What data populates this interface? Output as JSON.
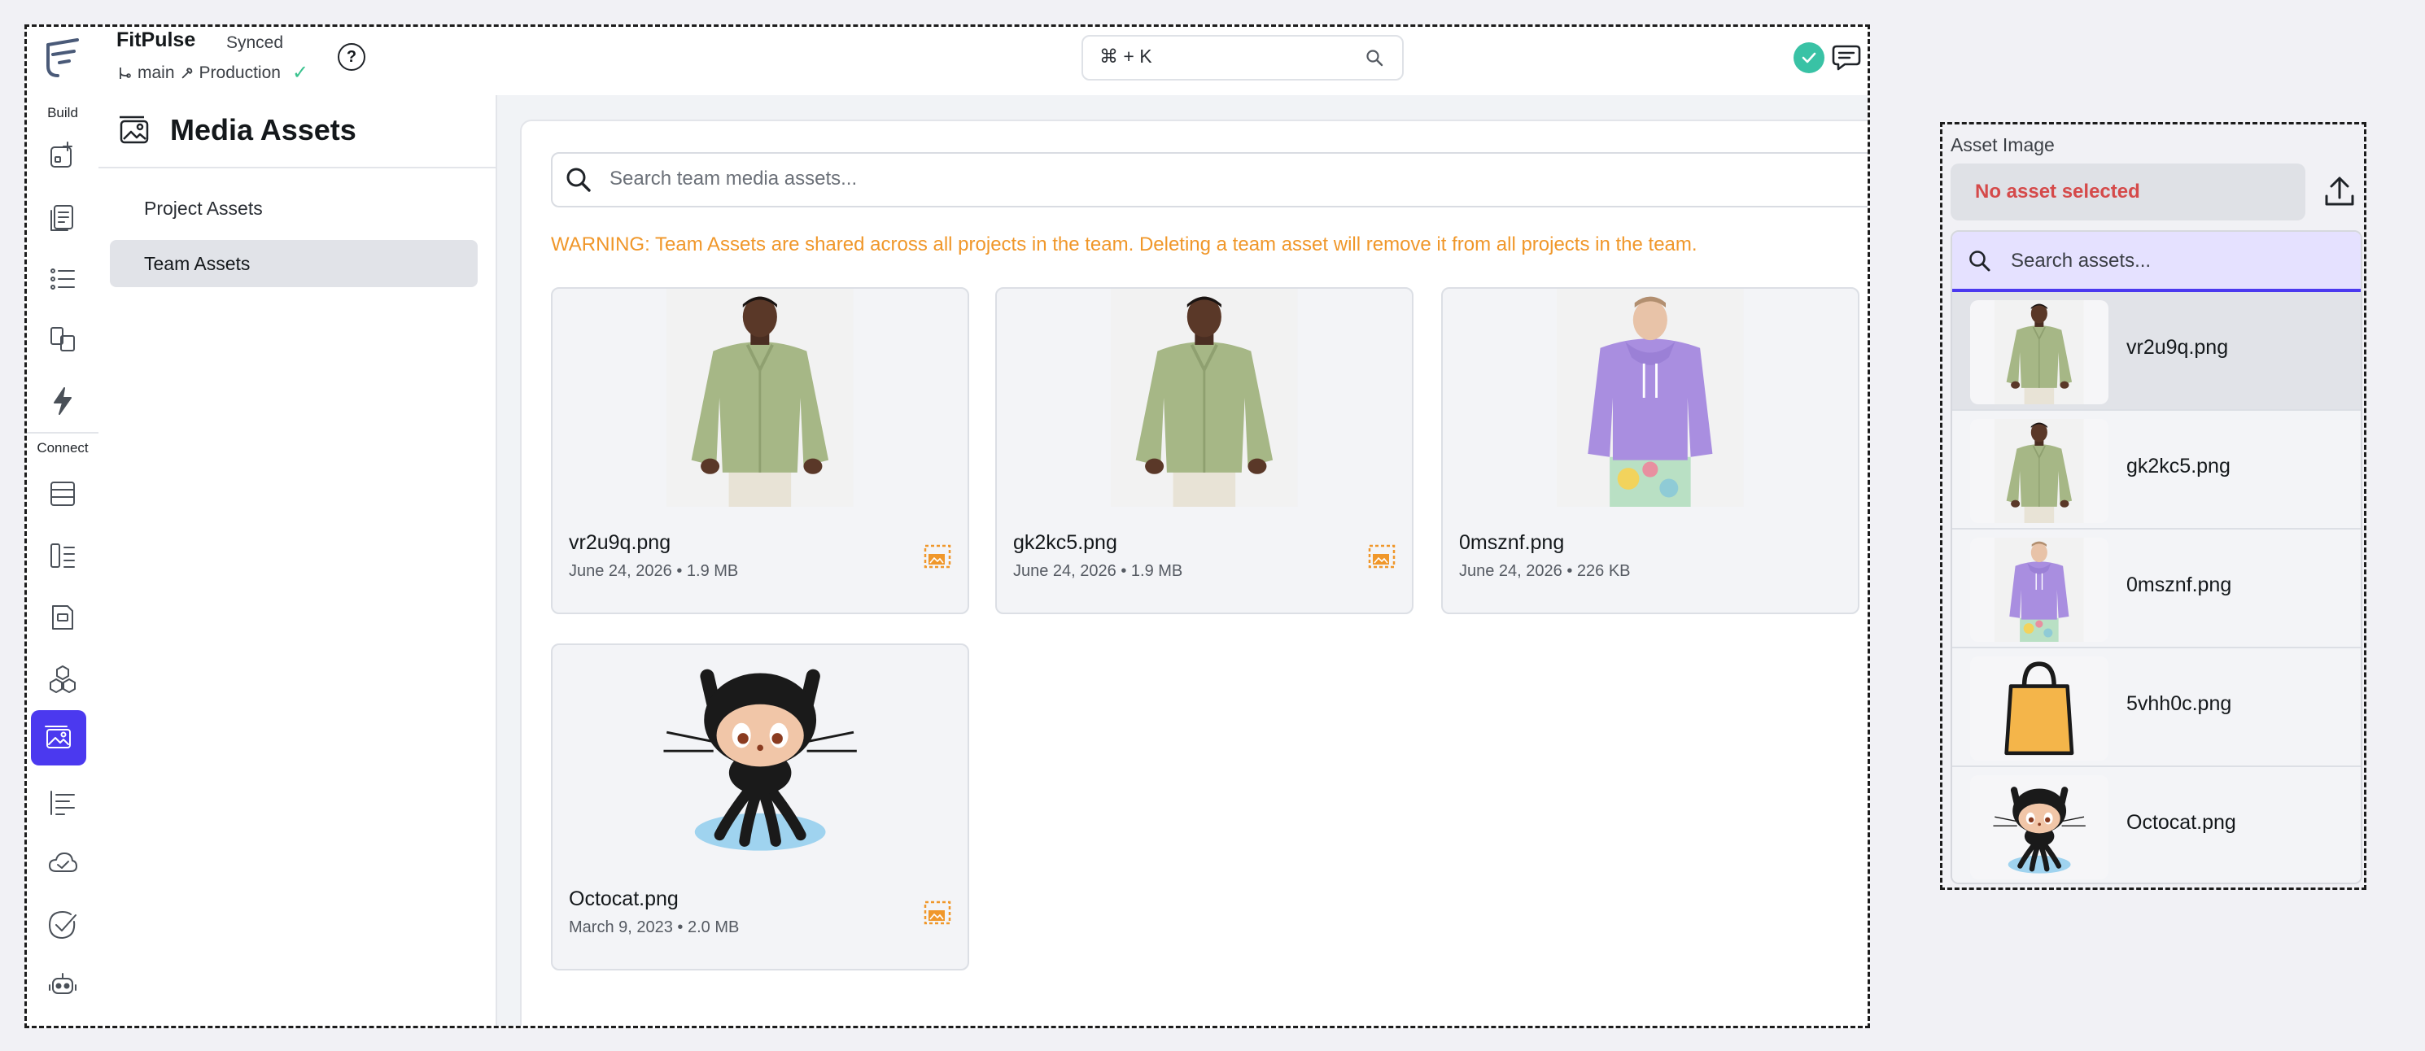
{
  "app": {
    "project_name": "FitPulse",
    "sync_status": "Synced",
    "branch": "main",
    "environment": "Production",
    "help_label": "?",
    "command_shortcut": "⌘ + K"
  },
  "rail": {
    "build_label": "Build",
    "connect_label": "Connect"
  },
  "subnav": {
    "title": "Media Assets",
    "items": [
      {
        "label": "Project Assets",
        "selected": false
      },
      {
        "label": "Team Assets",
        "selected": true
      }
    ]
  },
  "main": {
    "search_placeholder": "Search team media assets...",
    "warning": "WARNING: Team Assets are shared across all projects in the team. Deleting a team asset will remove it from all projects in the team.",
    "assets": [
      {
        "name": "vr2u9q.png",
        "meta": "June 24, 2026 • 1.9 MB",
        "thumb": "green-jacket"
      },
      {
        "name": "gk2kc5.png",
        "meta": "June 24, 2026 • 1.9 MB",
        "thumb": "green-jacket"
      },
      {
        "name": "0msznf.png",
        "meta": "June 24, 2026 • 226 KB",
        "thumb": "purple-hoodie"
      },
      {
        "name": "Octocat.png",
        "meta": "March 9, 2023 • 2.0 MB",
        "thumb": "octocat"
      }
    ]
  },
  "picker": {
    "label": "Asset Image",
    "empty_text": "No asset selected",
    "search_placeholder": "Search assets...",
    "items": [
      {
        "name": "vr2u9q.png",
        "thumb": "green-jacket",
        "selected": true
      },
      {
        "name": "gk2kc5.png",
        "thumb": "green-jacket",
        "selected": false
      },
      {
        "name": "0msznf.png",
        "thumb": "purple-hoodie",
        "selected": false
      },
      {
        "name": "5vhh0c.png",
        "thumb": "shopping-bag",
        "selected": false
      },
      {
        "name": "Octocat.png",
        "thumb": "octocat",
        "selected": false
      }
    ]
  },
  "colors": {
    "accent": "#4b39ef",
    "warning": "#f0972a",
    "error": "#d54a4a",
    "success": "#39c2a5"
  }
}
